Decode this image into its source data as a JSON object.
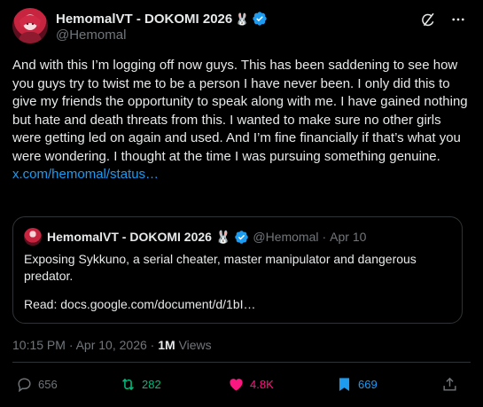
{
  "author": {
    "display_name": "HemomalVT - DOKOMI 2026",
    "name_emoji": "🐰",
    "handle": "@Hemomal"
  },
  "tweet": {
    "text": "And with this I’m logging off now guys. This has been saddening to see how you guys try to twist me to be a person I have never been. I only did this to give my friends the opportunity to speak along with me. I have gained nothing but hate and death threats from this. I wanted to make sure no other girls were getting led on again and used. And I’m fine financially if that’s what you were wondering. I thought at the time I was pursuing something genuine.",
    "link": "x.com/hemomal/status…"
  },
  "quote": {
    "display_name": "HemomalVT - DOKOMI 2026",
    "name_emoji": "🐰",
    "handle": "@Hemomal",
    "separator": "·",
    "date": "Apr 10",
    "text": "Exposing Sykkuno, a serial cheater, master manipulator and dangerous predator.",
    "read_line": "Read: docs.google.com/document/d/1bI…"
  },
  "meta": {
    "time": "10:15 PM · Apr 10, 2026 ·",
    "views_count": "1M",
    "views_label": "Views"
  },
  "actions": {
    "replies": "656",
    "reposts": "282",
    "likes": "4.8K",
    "bookmarks": "669"
  },
  "colors": {
    "background": "#000000",
    "text": "#e7e9ea",
    "secondary": "#71767b",
    "link": "#1d9bf0",
    "repost_active": "#00ba7c",
    "like_active": "#f91880",
    "bookmark_active": "#1d9bf0",
    "border": "#2f3336"
  },
  "icons": [
    "verified-badge-icon",
    "grok-icon",
    "more-icon",
    "reply-icon",
    "repost-icon",
    "like-icon",
    "bookmark-icon",
    "share-icon"
  ]
}
